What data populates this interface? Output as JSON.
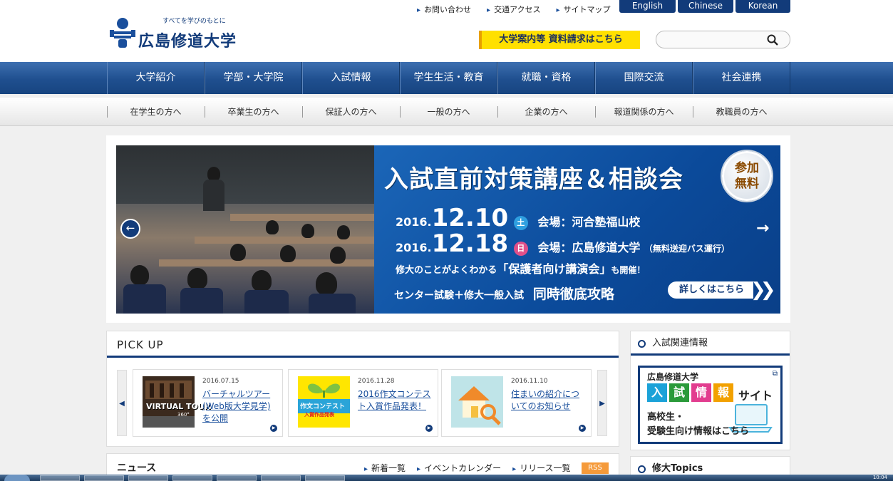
{
  "header": {
    "logo_tagline": "すべてを学びのもとに",
    "logo_name": "広島修道大学",
    "util_links": [
      "お問い合わせ",
      "交通アクセス",
      "サイトマップ"
    ],
    "languages": [
      "English",
      "Chinese",
      "Korean"
    ],
    "request_button": "大学案内等 資料請求はこちら",
    "search_placeholder": ""
  },
  "main_nav": [
    "大学紹介",
    "学部・大学院",
    "入試情報",
    "学生生活・教育",
    "就職・資格",
    "国際交流",
    "社会連携"
  ],
  "sub_nav": [
    "在学生の方へ",
    "卒業生の方へ",
    "保証人の方へ",
    "一般の方へ",
    "企業の方へ",
    "報道関係の方へ",
    "教職員の方へ"
  ],
  "banner": {
    "title": "入試直前対策講座＆相談会",
    "badge_line1": "参加",
    "badge_line2": "無料",
    "date1_year": "2016.",
    "date1_md": "12.10",
    "date1_dow": "土",
    "date1_venue": "会場：河合塾福山校",
    "date2_year": "2016.",
    "date2_md": "12.18",
    "date2_dow": "日",
    "date2_venue": "会場：広島修道大学",
    "date2_note": "（無料送迎バス運行）",
    "lecture_pre": "修大のことがよくわかる",
    "lecture_main": "「保護者向け講演会」",
    "lecture_post": "も開催！",
    "exam_line": "センター試験＋修大一般入試",
    "exam_strong": "同時徹底攻略",
    "cta": "詳しくはこちら",
    "colors": {
      "saturday": "#2f9fe0",
      "sunday": "#e0508a"
    }
  },
  "pickup": {
    "title": "PICK UP",
    "cards": [
      {
        "date": "2016.07.15",
        "title": "バーチャルツアー(Web版大学見学)を公開",
        "thumb_text": "VIRTUAL TOUR",
        "thumb_sub": "360°"
      },
      {
        "date": "2016.11.28",
        "title": "2016作文コンテスト入賞作品発表！",
        "thumb_text": "作文コンテスト",
        "thumb_sub": "入賞作品発表"
      },
      {
        "date": "2016.11.10",
        "title": "住まいの紹介についてのお知らせ"
      }
    ]
  },
  "news": {
    "title": "ニュース",
    "links": [
      "新着一覧",
      "イベントカレンダー",
      "リリース一覧"
    ],
    "rss": "RSS"
  },
  "sidebar": {
    "admission_title": "入試関連情報",
    "promo_line1": "広島修道大学",
    "promo_tiles": [
      "入",
      "試",
      "情",
      "報"
    ],
    "promo_tile_colors": [
      "#1ba2d8",
      "#2a9a3a",
      "#e23d8f",
      "#f2a100"
    ],
    "promo_site": "サイト",
    "promo_line2": "高校生・",
    "promo_line3": "受験生向け情報はこちら",
    "topics_title": "修大Topics"
  },
  "taskbar": {
    "clock": "10:04"
  }
}
